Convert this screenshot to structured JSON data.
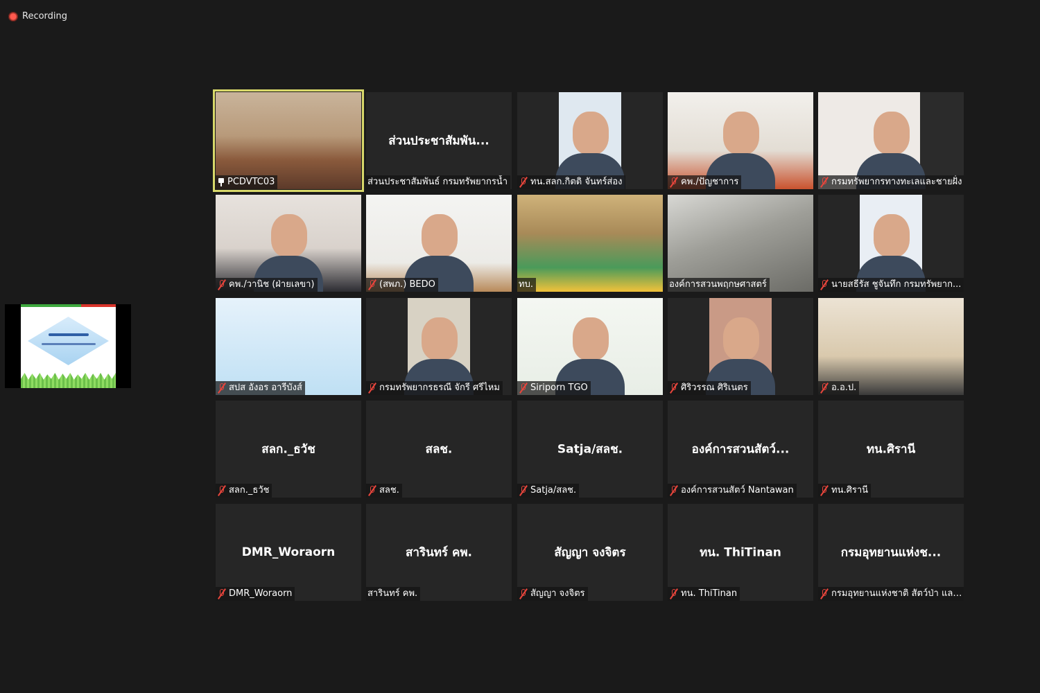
{
  "recording": {
    "label": "Recording"
  },
  "colors": {
    "tile_bg": "#262626",
    "page_bg": "#1a1a1a",
    "muted_red": "#e8453c",
    "active_border": "#d8d86a"
  },
  "tiles": [
    {
      "name": "PCDVTC03",
      "video": true,
      "icon": "pin-icon"
    },
    {
      "name": "ส่วนประชาสัมพันธ์ กรมทรัพยากรน้ำ",
      "center": "ส่วนประชาสัมพัน...",
      "video": false,
      "icon": ""
    },
    {
      "name": "ทน.สลก.กิตติ จันทร์ส่อง",
      "video": true,
      "icon": "mic-muted-icon"
    },
    {
      "name": "คพ./ปัญชาการ",
      "video": true,
      "icon": "mic-muted-icon"
    },
    {
      "name": "กรมทรัพยากรทางทะเลและชายฝั่ง",
      "video": true,
      "icon": "mic-muted-icon"
    },
    {
      "name": "คพ./วานิช (ฝ่ายเลขา)",
      "video": true,
      "icon": "mic-muted-icon"
    },
    {
      "name": "(สพภ.) BEDO",
      "video": true,
      "icon": "mic-muted-icon"
    },
    {
      "name": "ทบ.",
      "video": true,
      "icon": ""
    },
    {
      "name": "องค์การสวนพฤกษศาสตร์",
      "video": true,
      "icon": ""
    },
    {
      "name": "นายสธีรัส ชูจันทึก กรมทรัพยาก...",
      "video": true,
      "icon": "mic-muted-icon"
    },
    {
      "name": "สปส อังอร อารีบังส์",
      "video": true,
      "icon": "mic-muted-icon"
    },
    {
      "name": "กรมทรัพยากรธรณี จักรี ศรีไหม",
      "video": true,
      "icon": "mic-muted-icon"
    },
    {
      "name": "Siriporn TGO",
      "video": true,
      "icon": "mic-muted-icon"
    },
    {
      "name": "ศิริวรรณ ศิริเนตร",
      "video": true,
      "icon": "mic-muted-icon"
    },
    {
      "name": "อ.อ.ป.",
      "video": true,
      "icon": "mic-muted-icon"
    },
    {
      "name": "สลก._ธวัช",
      "center": "สลก._ธวัช",
      "video": false,
      "icon": "mic-muted-icon"
    },
    {
      "name": "สลช.",
      "center": "สลช.",
      "video": false,
      "icon": "mic-muted-icon"
    },
    {
      "name": "Satja/สลช.",
      "center": "Satja/สลช.",
      "video": false,
      "icon": "mic-muted-icon"
    },
    {
      "name": "องค์การสวนสัตว์ Nantawan",
      "center": "องค์การสวนสัตว์...",
      "video": false,
      "icon": "mic-muted-icon"
    },
    {
      "name": "ทน.ศิรานี",
      "center": "ทน.ศิรานี",
      "video": false,
      "icon": "mic-muted-icon"
    },
    {
      "name": "DMR_Woraorn",
      "center": "DMR_Woraorn",
      "video": false,
      "icon": "mic-muted-icon"
    },
    {
      "name": "สารินทร์ คพ.",
      "center": "สารินทร์ คพ.",
      "video": false,
      "icon": ""
    },
    {
      "name": "สัญญา จงจิตร",
      "center": "สัญญา จงจิตร",
      "video": false,
      "icon": "mic-muted-icon"
    },
    {
      "name": "ทน. ThiTinan",
      "center": "ทน. ThiTinan",
      "video": false,
      "icon": "mic-muted-icon"
    },
    {
      "name": "กรมอุทยานแห่งชาติ สัตว์ป่า และ...",
      "center": "กรมอุทยานแห่งช...",
      "video": false,
      "icon": "mic-muted-icon"
    }
  ]
}
